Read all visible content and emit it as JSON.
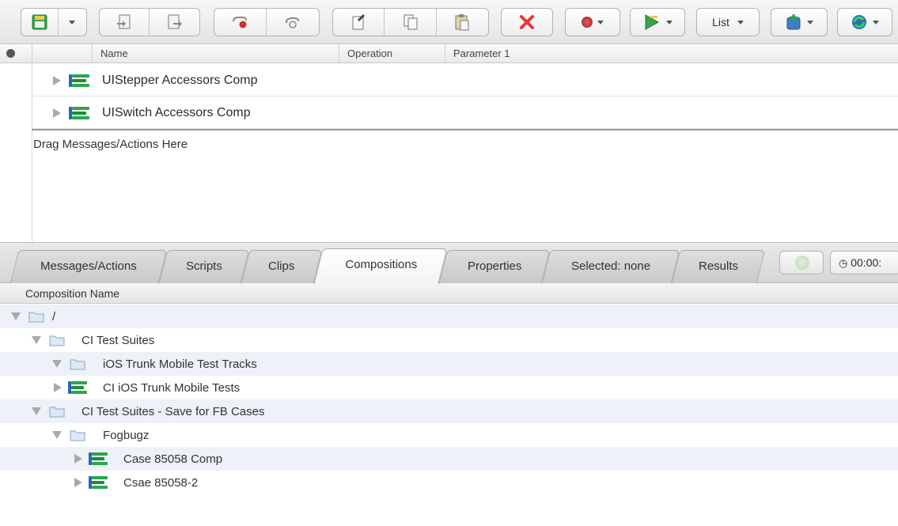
{
  "toolbar": {
    "view_dropdown_label": "List",
    "colors": {
      "record": "#c62828",
      "play": "#2e9e3e",
      "stop": "#e53935"
    }
  },
  "upper_table": {
    "columns": [
      "Name",
      "Operation",
      "Parameter 1"
    ],
    "rows": [
      {
        "name": "UIStepper Accessors Comp"
      },
      {
        "name": "UISwitch Accessors Comp"
      }
    ],
    "drop_hint": "Drag Messages/Actions Here"
  },
  "tabs": [
    {
      "label": "Messages/Actions",
      "active": false
    },
    {
      "label": "Scripts",
      "active": false
    },
    {
      "label": "Clips",
      "active": false
    },
    {
      "label": "Compositions",
      "active": true
    },
    {
      "label": "Properties",
      "active": false
    },
    {
      "label": "Selected: none",
      "active": false
    },
    {
      "label": "Results",
      "active": false
    }
  ],
  "timer": {
    "value": "00:00:"
  },
  "compositions": {
    "column_header": "Composition Name",
    "tree": [
      {
        "label": "/",
        "type": "folder",
        "expanded": true
      },
      {
        "label": "CI Test Suites",
        "type": "folder",
        "expanded": true
      },
      {
        "label": "iOS Trunk Mobile Test Tracks",
        "type": "folder",
        "expanded": true
      },
      {
        "label": "CI iOS Trunk Mobile Tests",
        "type": "composition",
        "expanded": false
      },
      {
        "label": "CI Test Suites - Save for FB Cases",
        "type": "folder",
        "expanded": true
      },
      {
        "label": "Fogbugz",
        "type": "folder",
        "expanded": true
      },
      {
        "label": "Case 85058 Comp",
        "type": "composition",
        "expanded": false
      },
      {
        "label": "Csae 85058-2",
        "type": "composition",
        "expanded": false
      }
    ]
  }
}
